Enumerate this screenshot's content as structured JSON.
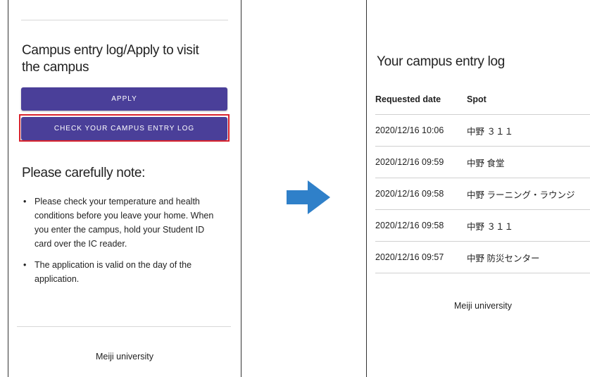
{
  "left": {
    "section_title": "Campus entry log/Apply to visit the campus",
    "apply_label": "APPLY",
    "check_log_label": "CHECK YOUR CAMPUS ENTRY LOG",
    "note_heading": "Please carefully note:",
    "notes": [
      "Please check your temperature and health conditions before you leave your home. When you enter the campus, hold your Student ID card over the IC reader.",
      "The application is valid on the day of the application."
    ],
    "footer": "Meiji university"
  },
  "right": {
    "title": "Your campus entry log",
    "headers": {
      "date": "Requested date",
      "spot": "Spot"
    },
    "rows": [
      {
        "date": "2020/12/16 10:06",
        "spot": "中野 ３１１"
      },
      {
        "date": "2020/12/16 09:59",
        "spot": "中野 食堂"
      },
      {
        "date": "2020/12/16 09:58",
        "spot": "中野 ラーニング・ラウンジ"
      },
      {
        "date": "2020/12/16 09:58",
        "spot": "中野 ３１１"
      },
      {
        "date": "2020/12/16 09:57",
        "spot": "中野 防災センター"
      }
    ],
    "footer": "Meiji university"
  },
  "colors": {
    "button": "#4a3f99",
    "highlight": "#d9232e",
    "arrow": "#2f80c9"
  },
  "icons": {
    "transition": "right-arrow-icon",
    "bullet": "bullet-icon"
  }
}
